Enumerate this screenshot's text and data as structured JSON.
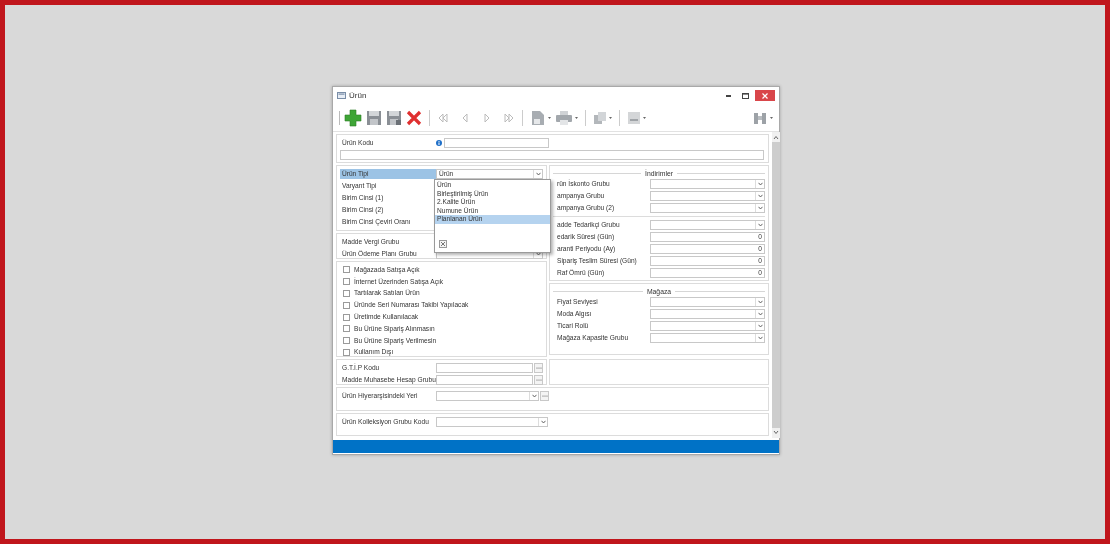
{
  "window": {
    "title": "Ürün"
  },
  "code": {
    "label": "Ürün Kodu"
  },
  "general": [
    {
      "label": "Ürün Tipi",
      "selected": true,
      "kind": "combo",
      "value": "Ürün"
    },
    {
      "label": "Varyant Tipi",
      "selected": false,
      "kind": "covered"
    },
    {
      "label": "Birim Cinsi (1)",
      "selected": false,
      "kind": "covered"
    },
    {
      "label": "Birim Cinsi (2)",
      "selected": false,
      "kind": "covered"
    },
    {
      "label": "Birim Cinsi Çeviri Oranı",
      "selected": false,
      "kind": "covered"
    }
  ],
  "type_dropdown": {
    "items": [
      {
        "label": "Ürün",
        "selected": false
      },
      {
        "label": "Birleştirilmiş Ürün",
        "selected": false
      },
      {
        "label": "2.Kalite Ürün",
        "selected": false
      },
      {
        "label": "Numune Ürün",
        "selected": false
      },
      {
        "label": "Planlanan Ürün",
        "selected": true
      }
    ]
  },
  "tax": [
    {
      "label": "Madde Vergi Grubu",
      "kind": "covered"
    },
    {
      "label": "Ürün Ödeme Planı Grubu",
      "kind": "combo"
    }
  ],
  "flags": [
    {
      "label": "Mağazada Satışa Açık",
      "checked": false
    },
    {
      "label": "İnternet Üzerinden Satışa Açık",
      "checked": false
    },
    {
      "label": "Tartılarak Satılan Ürün",
      "checked": false
    },
    {
      "label": "Üründe Seri Numarası Takibi Yapılacak",
      "checked": false
    },
    {
      "label": "Üretimde Kullanılacak",
      "checked": false
    },
    {
      "label": "Bu Ürüne Sipariş Alınmasın",
      "checked": false
    },
    {
      "label": "Bu Ürüne Sipariş Verilmesin",
      "checked": false
    },
    {
      "label": "Kullanım Dışı",
      "checked": false
    }
  ],
  "discounts": {
    "title": "İndirimler",
    "rows": [
      {
        "label": "rün İskonto Grubu",
        "kind": "combo"
      },
      {
        "label": "ampanya Grubu",
        "kind": "combo"
      },
      {
        "label": "ampanya Grubu (2)",
        "kind": "combo"
      }
    ]
  },
  "supply": [
    {
      "label": "adde Tedarikçi Grubu",
      "kind": "combo"
    },
    {
      "label": "edarik Süresi (Gün)",
      "kind": "number",
      "value": "0"
    },
    {
      "label": "aranti Periyodu (Ay)",
      "kind": "number",
      "value": "0"
    },
    {
      "label": "Sipariş Teslim Süresi (Gün)",
      "kind": "number",
      "value": "0"
    },
    {
      "label": "Raf Ömrü (Gün)",
      "kind": "number",
      "value": "0"
    }
  ],
  "store": {
    "title": "Mağaza",
    "rows": [
      {
        "label": "Fiyat Seviyesi",
        "kind": "combo"
      },
      {
        "label": "Moda Algısı",
        "kind": "combo"
      },
      {
        "label": "Ticari Rolü",
        "kind": "combo"
      },
      {
        "label": "Mağaza Kapasite Grubu",
        "kind": "combo"
      }
    ]
  },
  "codes": [
    {
      "label": "G.T.İ.P Kodu",
      "kind": "lookup"
    },
    {
      "label": "Madde Muhasebe Hesap Grubu",
      "kind": "lookup"
    }
  ],
  "hierarchy": {
    "label": "Ürün Hiyerarşisindeki Yeri",
    "kind": "combo_lookup"
  },
  "collection": {
    "label": "Ürün Kolleksiyon Grubu Kodu",
    "kind": "combo"
  }
}
